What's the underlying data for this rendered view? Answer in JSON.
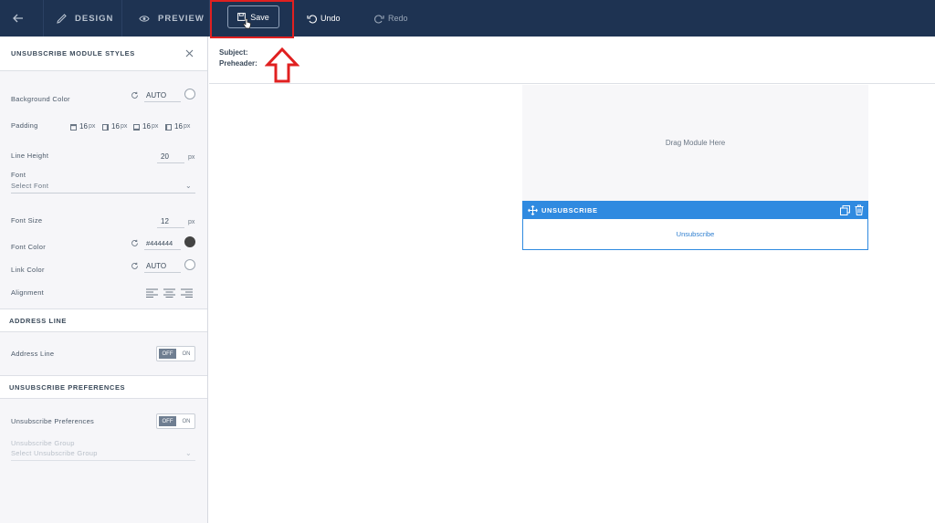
{
  "topbar": {
    "design_label": "DESIGN",
    "preview_label": "PREVIEW",
    "save_label": "Save",
    "undo_label": "Undo",
    "redo_label": "Redo"
  },
  "sidebar": {
    "title": "UNSUBSCRIBE MODULE STYLES",
    "background_color": {
      "label": "Background Color",
      "value": "AUTO"
    },
    "padding": {
      "label": "Padding",
      "unit": "px",
      "values": [
        "16",
        "16",
        "16",
        "16"
      ]
    },
    "line_height": {
      "label": "Line Height",
      "value": "20",
      "unit": "px"
    },
    "font": {
      "label": "Font",
      "placeholder": "Select Font"
    },
    "font_size": {
      "label": "Font Size",
      "value": "12",
      "unit": "px"
    },
    "font_color": {
      "label": "Font Color",
      "value": "#444444",
      "swatch": "#444444"
    },
    "link_color": {
      "label": "Link Color",
      "value": "AUTO"
    },
    "alignment": {
      "label": "Alignment"
    },
    "address_section": {
      "title": "ADDRESS LINE",
      "label": "Address Line",
      "toggle_off": "OFF",
      "toggle_on": "ON"
    },
    "unsub_section": {
      "title": "UNSUBSCRIBE PREFERENCES",
      "label": "Unsubscribe Preferences",
      "toggle_off": "OFF",
      "toggle_on": "ON",
      "group_label": "Unsubscribe Group",
      "group_placeholder": "Select Unsubscribe Group"
    }
  },
  "main": {
    "subject_label": "Subject:",
    "preheader_label": "Preheader:",
    "drag_text": "Drag Module Here",
    "module_title": "UNSUBSCRIBE",
    "module_link": "Unsubscribe"
  },
  "colors": {
    "topbar": "#1e3352",
    "accent": "#2f8ae0",
    "highlight": "#e02020"
  }
}
